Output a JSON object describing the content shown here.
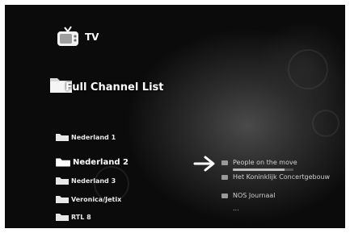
{
  "header": {
    "title": "TV",
    "icon": "tv-icon"
  },
  "section": {
    "title": "Full Channel List",
    "icon": "folder-icon"
  },
  "channels": [
    {
      "label": "Nederland 1"
    },
    {
      "label": "Nederland 2",
      "selected": true
    },
    {
      "label": "Nederland 3"
    },
    {
      "label": "Veronica/Jetix"
    },
    {
      "label": "RTL 8"
    }
  ],
  "programs": {
    "items": [
      {
        "label": "People on the move",
        "progress": 0.85
      },
      {
        "label": "Het Koninklijk Concertgebouw"
      },
      {
        "label": "NOS Journaal"
      }
    ],
    "more_label": "..."
  },
  "colors": {
    "background": "#0b0b0b",
    "text": "#ffffff",
    "muted_text": "#cfcfcf",
    "progress_fill": "#bdbdbd"
  }
}
